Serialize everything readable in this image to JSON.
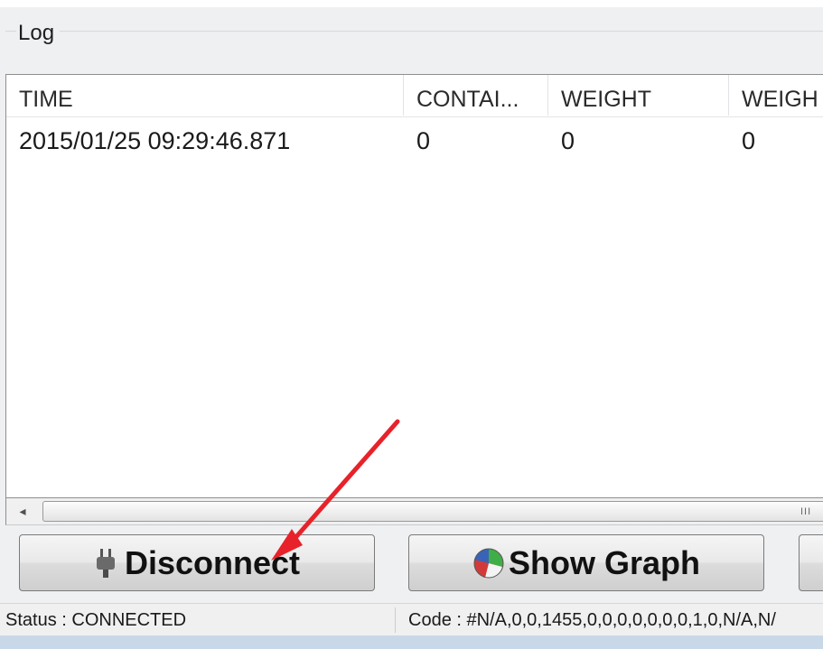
{
  "log": {
    "group_title": "Log",
    "columns": [
      "TIME",
      "CONTAI...",
      "WEIGHT",
      "WEIGH"
    ],
    "rows": [
      [
        "2015/01/25 09:29:46.871",
        "0",
        "0",
        "0"
      ]
    ]
  },
  "scrollbar": {
    "left_arrow": "◂",
    "grip": "III"
  },
  "buttons": {
    "disconnect": "Disconnect",
    "show_graph": "Show Graph"
  },
  "status": {
    "left": "Status : CONNECTED",
    "right": "Code : #N/A,0,0,1455,0,0,0,0,0,0,0,1,0,N/A,N/"
  },
  "colors": {
    "annotation_arrow": "#e8222a"
  },
  "icons": {
    "disconnect": "plug-icon",
    "show_graph": "pie-chart-icon"
  }
}
